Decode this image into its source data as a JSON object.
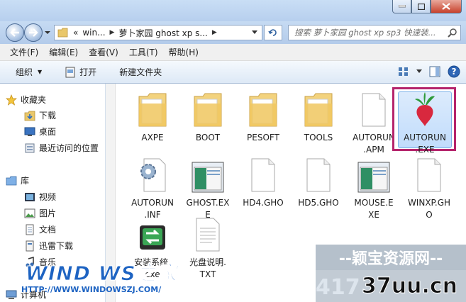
{
  "address": {
    "prefix": "«",
    "crumbs": [
      "win...",
      "萝卜家园 ghost xp s..."
    ],
    "search_placeholder": "搜索 萝卜家园 ghost xp sp3 快速装..."
  },
  "menu": [
    "文件(F)",
    "编辑(E)",
    "查看(V)",
    "工具(T)",
    "帮助(H)"
  ],
  "toolbar": {
    "organize": "组织",
    "open": "打开",
    "new_folder": "新建文件夹"
  },
  "nav": {
    "favorites": "收藏夹",
    "downloads": "下载",
    "desktop": "桌面",
    "recent": "最近访问的位置",
    "libraries": "库",
    "videos": "视频",
    "pictures": "图片",
    "documents": "文档",
    "thunder": "迅雷下载",
    "music": "音乐",
    "computer": "计算机"
  },
  "files": [
    {
      "name": "AXPE",
      "type": "folder"
    },
    {
      "name": "BOOT",
      "type": "folder"
    },
    {
      "name": "PESOFT",
      "type": "folder"
    },
    {
      "name": "TOOLS",
      "type": "folder"
    },
    {
      "name": "AUTORUN\n.APM",
      "type": "document"
    },
    {
      "name": "AUTORUN\n.EXE",
      "type": "radish-app"
    },
    {
      "name": "AUTORUN\n.INF",
      "type": "settings-file"
    },
    {
      "name": "GHOST.EX\nE",
      "type": "exe-window"
    },
    {
      "name": "HD4.GHO",
      "type": "document"
    },
    {
      "name": "HD5.GHO",
      "type": "document"
    },
    {
      "name": "MOUSE.E\nXE",
      "type": "exe-window"
    },
    {
      "name": "WINXP.GH\nO",
      "type": "document"
    },
    {
      "name": "安装系统.\nexe",
      "type": "install-app"
    },
    {
      "name": "光盘说明.\nTXT",
      "type": "text-file"
    }
  ],
  "watermark": {
    "left_logo": "WIND WS之家",
    "left_url": "HTTP://WWW.WINDOWSZJ.COM/",
    "right_title": "--颖宝资源网--",
    "right_num": "417",
    "right_site": "37uu.cn"
  },
  "colors": {
    "selection_border": "#b5246c",
    "accent": "#1d63c2"
  }
}
